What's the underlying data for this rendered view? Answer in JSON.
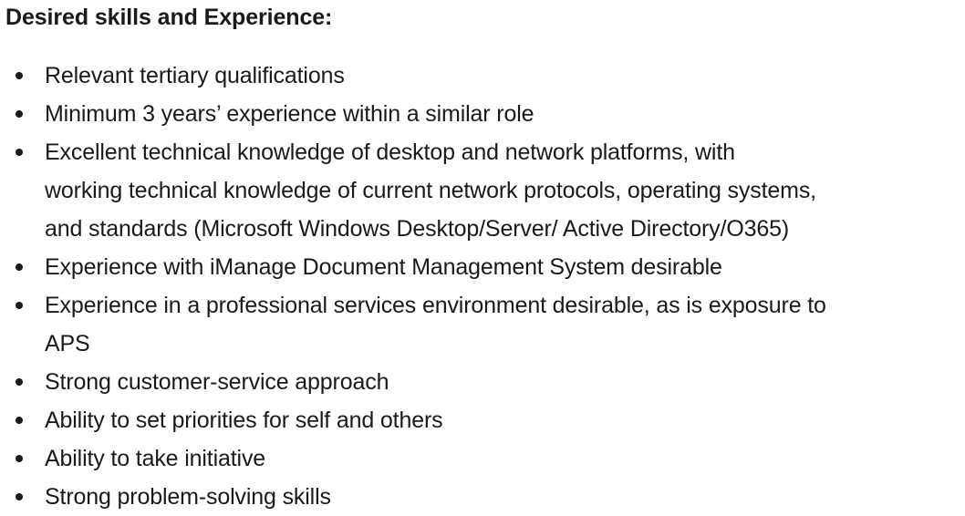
{
  "heading": "Desired skills and Experience:",
  "items": [
    {
      "lines": [
        "Relevant tertiary qualifications"
      ]
    },
    {
      "lines": [
        "Minimum 3 years’ experience within a similar role"
      ]
    },
    {
      "lines": [
        "Excellent technical knowledge of desktop and network platforms, with",
        "working technical knowledge of current network protocols, operating systems,",
        "and standards (Microsoft Windows Desktop/Server/ Active Directory/O365)"
      ]
    },
    {
      "lines": [
        "Experience with iManage Document Management System desirable"
      ]
    },
    {
      "lines": [
        "Experience in a professional services environment desirable, as is exposure to",
        "APS"
      ]
    },
    {
      "lines": [
        "Strong customer-service approach"
      ]
    },
    {
      "lines": [
        "Ability to set priorities for self and others"
      ]
    },
    {
      "lines": [
        "Ability to take initiative"
      ]
    },
    {
      "lines": [
        "Strong problem-solving skills"
      ]
    }
  ]
}
